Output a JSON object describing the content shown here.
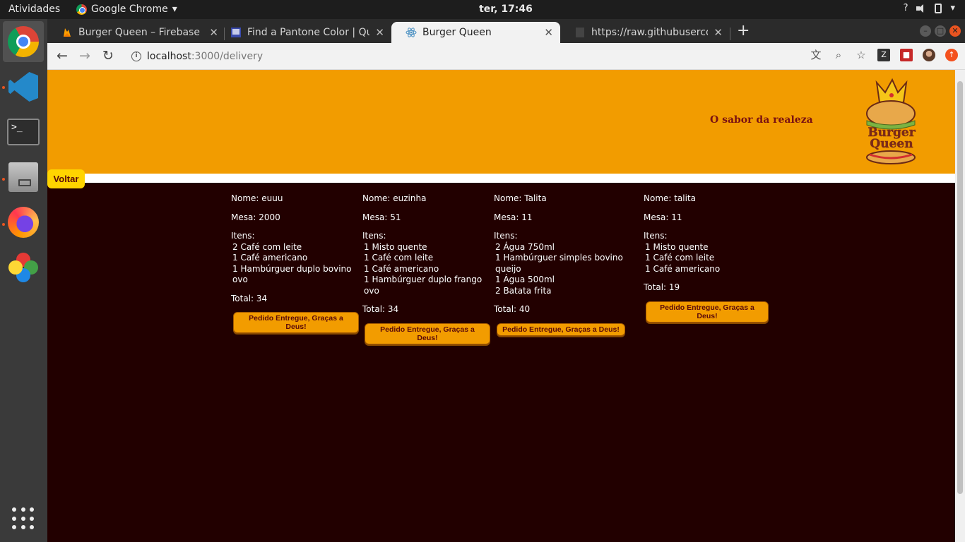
{
  "os": {
    "activities": "Atividades",
    "app_name": "Google Chrome",
    "clock": "ter, 17:46",
    "help": "?"
  },
  "browser": {
    "tabs": [
      {
        "title": "Burger Queen – Firebase c",
        "active": false
      },
      {
        "title": "Find a Pantone Color | Qu",
        "active": false
      },
      {
        "title": "Burger Queen",
        "active": true
      },
      {
        "title": "https://raw.githubusercont",
        "active": false
      }
    ],
    "url_host": "localhost",
    "url_path": ":3000/delivery"
  },
  "page": {
    "slogan": "O sabor da realeza",
    "logo_text": [
      "Burger",
      "Queen"
    ],
    "back_label": "Voltar",
    "orders": [
      {
        "name": "Nome: euuu",
        "table": "Mesa: 2000",
        "items_label": "Itens:",
        "items": [
          "2 Café com leite",
          "1 Café americano",
          "1 Hambúrguer duplo bovino ovo"
        ],
        "total": "Total: 34",
        "button": "Pedido Entregue, Graças a Deus!"
      },
      {
        "name": "Nome: euzinha",
        "table": "Mesa: 51",
        "items_label": "Itens:",
        "items": [
          "1 Misto quente",
          "1 Café com leite",
          "1 Café americano",
          "1 Hambúrguer duplo frango ovo"
        ],
        "total": "Total: 34",
        "button": "Pedido Entregue, Graças a Deus!"
      },
      {
        "name": "Nome: Talita",
        "table": "Mesa: 11",
        "items_label": "Itens:",
        "items": [
          "2 Água 750ml",
          "1 Hambúrguer simples bovino queijo",
          "1 Água 500ml",
          "2 Batata frita"
        ],
        "total": "Total: 40",
        "button": "Pedido Entregue, Graças a Deus!"
      },
      {
        "name": "Nome: talita",
        "table": "Mesa: 11",
        "items_label": "Itens:",
        "items": [
          "1 Misto quente",
          "1 Café com leite",
          "1 Café americano"
        ],
        "total": "Total: 19",
        "button": "Pedido Entregue, Graças a Deus!"
      }
    ]
  },
  "colors": {
    "header_bg": "#f29c00",
    "page_bg": "#220000",
    "back_button_bg": "#ffd400",
    "slogan_text": "#7a1212"
  },
  "icons": {
    "dock": [
      "chrome-icon",
      "vscode-icon",
      "terminal-icon",
      "files-icon",
      "firefox-icon",
      "clover-icon",
      "app-grid-icon"
    ],
    "toolbar": [
      "translate-icon",
      "zoom-icon",
      "bookmark-star-icon",
      "extension-icon",
      "extension-icon",
      "profile-avatar-icon",
      "update-icon"
    ]
  }
}
